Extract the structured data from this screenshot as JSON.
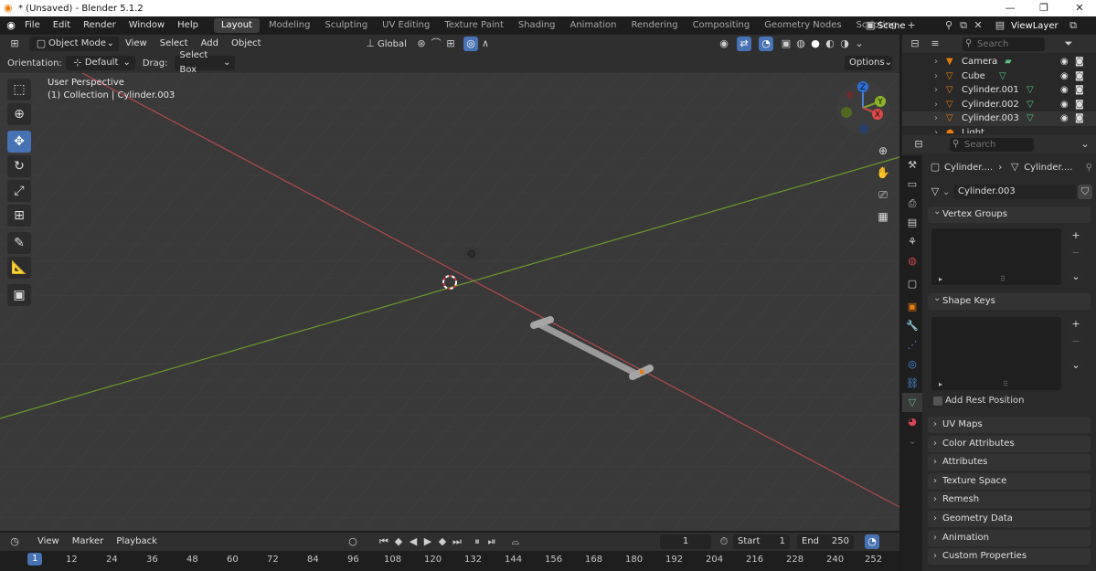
{
  "window": {
    "title": "* (Unsaved) - Blender 5.1.2",
    "min": "—",
    "max": "❐",
    "close": "✕"
  },
  "menus": [
    "File",
    "Edit",
    "Render",
    "Window",
    "Help"
  ],
  "workspaces": [
    "Layout",
    "Modeling",
    "Sculpting",
    "UV Editing",
    "Texture Paint",
    "Shading",
    "Animation",
    "Rendering",
    "Compositing",
    "Geometry Nodes",
    "Scripting"
  ],
  "active_workspace": "Layout",
  "scene": {
    "name": "Scene",
    "view_layer": "ViewLayer"
  },
  "viewport_header": {
    "mode": "Object Mode",
    "menus": [
      "View",
      "Select",
      "Add",
      "Object"
    ],
    "transform": "Global"
  },
  "tool_settings": {
    "orientation_label": "Orientation:",
    "orientation_value": "Default",
    "drag_label": "Drag:",
    "drag_value": "Select Box",
    "options": "Options"
  },
  "viewport": {
    "perspective": "User Perspective",
    "collection": "(1) Collection | Cylinder.003"
  },
  "gizmo": {
    "z": "Z",
    "y": "Y",
    "x": "X"
  },
  "outliner": {
    "search_placeholder": "Search",
    "items": [
      {
        "name": "Camera",
        "icon": "camera-icon"
      },
      {
        "name": "Cube",
        "icon": "mesh-icon"
      },
      {
        "name": "Cylinder.001",
        "icon": "mesh-icon"
      },
      {
        "name": "Cylinder.002",
        "icon": "mesh-icon"
      },
      {
        "name": "Cylinder.003",
        "icon": "mesh-icon"
      },
      {
        "name": "Light",
        "icon": "light-icon"
      }
    ]
  },
  "properties": {
    "search_placeholder": "Search",
    "breadcrumb_object": "Cylinder....",
    "breadcrumb_data": "Cylinder....",
    "mesh_name": "Cylinder.003",
    "vertex_groups": "Vertex Groups",
    "shape_keys": "Shape Keys",
    "add_rest_position": "Add Rest Position",
    "panels": [
      "UV Maps",
      "Color Attributes",
      "Attributes",
      "Texture Space",
      "Remesh",
      "Geometry Data",
      "Animation",
      "Custom Properties"
    ]
  },
  "timeline": {
    "menus": [
      "View",
      "Marker",
      "Playback"
    ],
    "current_frame": "1",
    "start_label": "Start",
    "start": "1",
    "end_label": "End",
    "end": "250",
    "ruler": [
      "1",
      "12",
      "24",
      "36",
      "48",
      "60",
      "72",
      "84",
      "96",
      "108",
      "120",
      "132",
      "144",
      "156",
      "168",
      "180",
      "192",
      "204",
      "216",
      "228",
      "240",
      "252"
    ]
  },
  "colors": {
    "accent": "#4772b3",
    "x_axis": "#b4484d",
    "y_axis": "#6a9a2a",
    "mesh_green": "#5cbf82",
    "orange": "#e87d0d"
  }
}
